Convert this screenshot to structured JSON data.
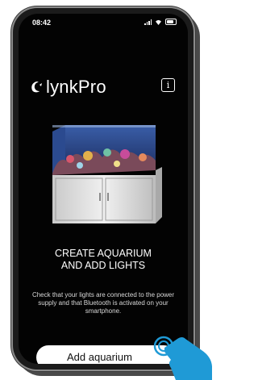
{
  "status_bar": {
    "time": "08:42"
  },
  "header": {
    "logo_text": "lynkPro",
    "info_icon": "info-icon",
    "info_glyph": "i"
  },
  "hero": {
    "image": "aquarium-tank-illustration"
  },
  "content": {
    "title_line1": "CREATE AQUARIUM",
    "title_line2": "AND ADD LIGHTS",
    "description": "Check that your lights are connected to the power supply and that Bluetooth is activated on your smartphone."
  },
  "actions": {
    "add_label": "Add aquarium"
  },
  "colors": {
    "background": "#030303",
    "text": "#ffffff",
    "button_bg": "#ffffff",
    "tap_hand": "#1f9ad6"
  }
}
